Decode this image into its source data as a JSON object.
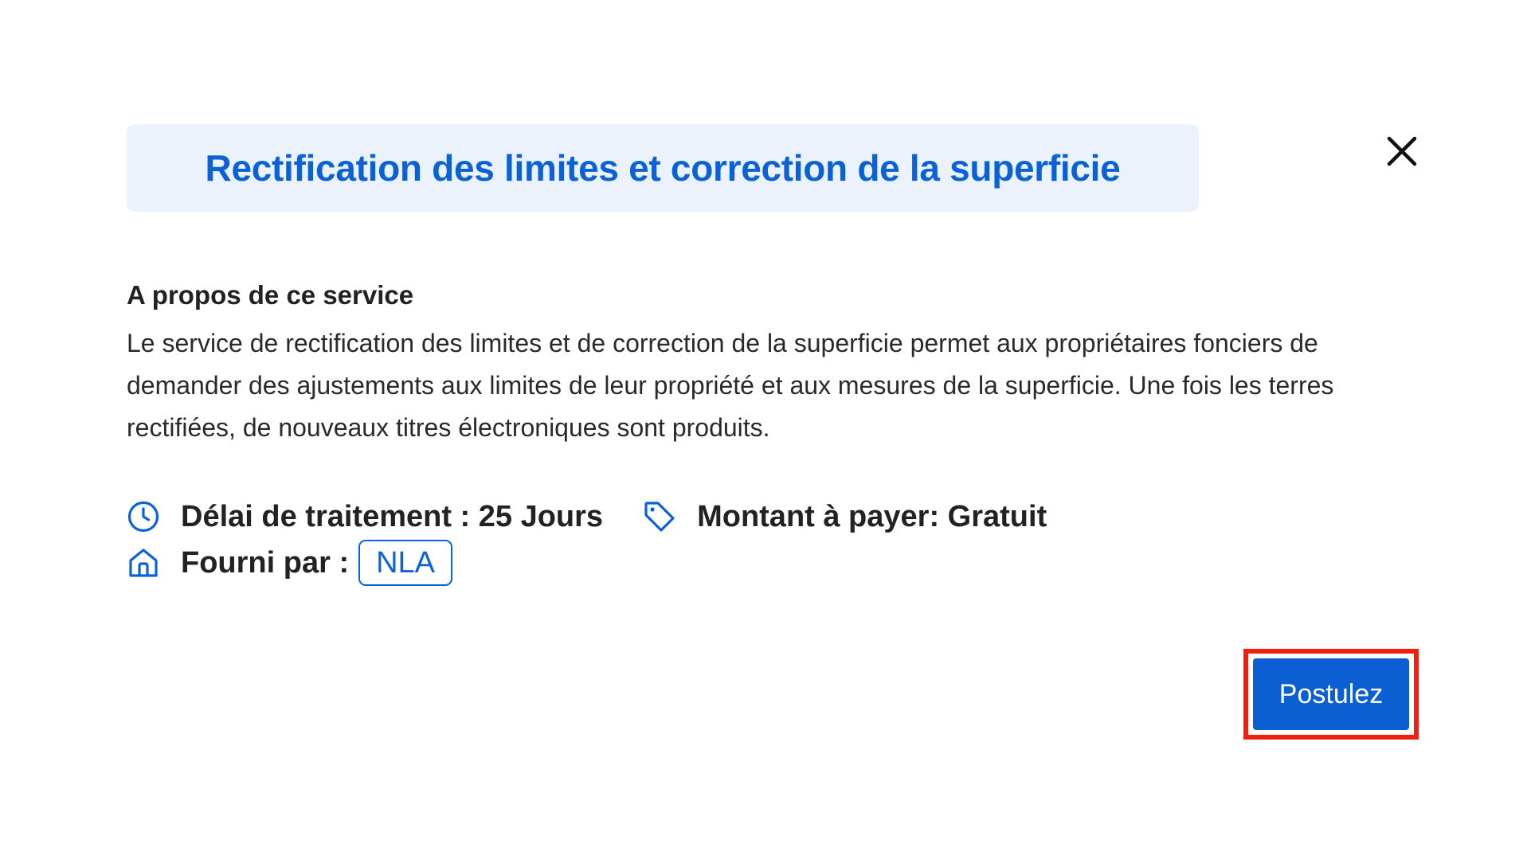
{
  "modal": {
    "title": "Rectification des limites et correction de la superficie",
    "close_icon": "close-icon"
  },
  "about": {
    "heading": "A propos de ce service",
    "description": "Le service de rectification des limites et de correction de la superficie permet aux propriétaires fonciers de demander des ajustements aux limites de leur propriété et aux mesures de la superficie. Une fois les terres rectifiées, de nouveaux titres électroniques sont produits."
  },
  "meta": {
    "processing_time": "Délai de traitement : 25 Jours",
    "amount": "Montant à payer: Gratuit",
    "provided_by_label": "Fourni par :",
    "provider": "NLA",
    "icons": {
      "processing_time": "clock-icon",
      "amount": "tag-icon",
      "provided_by": "home-icon"
    }
  },
  "actions": {
    "apply_label": "Postulez"
  },
  "colors": {
    "accent": "#0b62d6",
    "title_background": "#ebf2fb",
    "highlight_border": "#f0200f"
  }
}
